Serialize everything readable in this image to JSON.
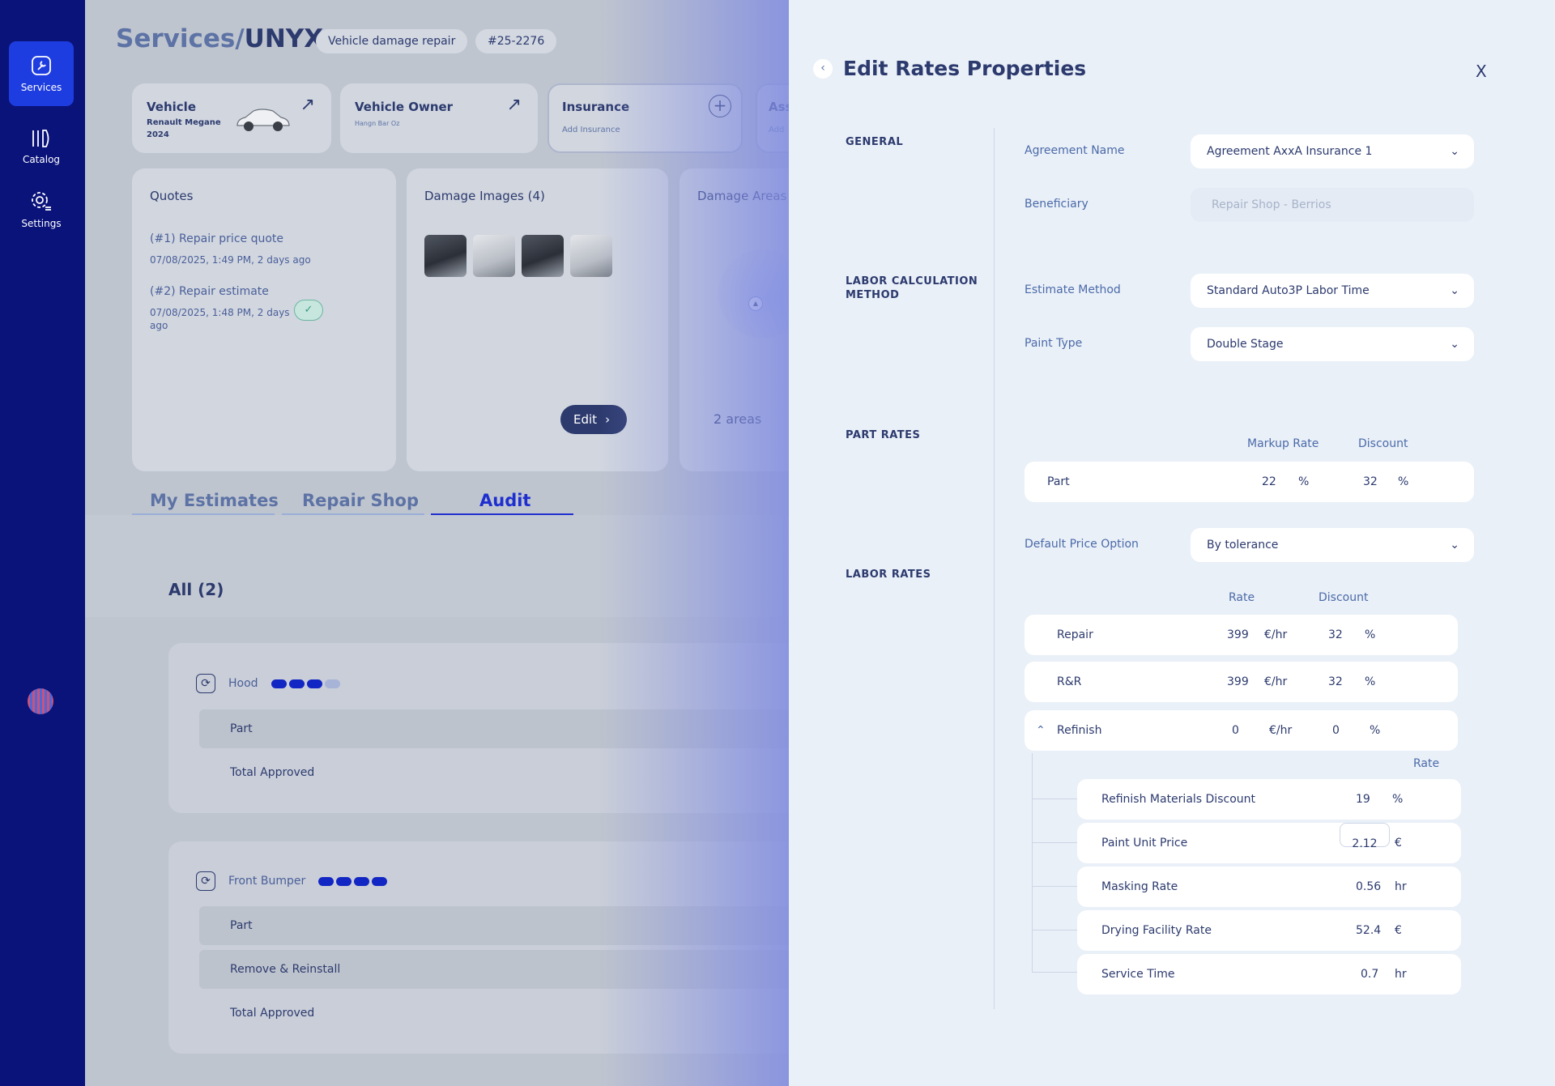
{
  "sidebar": {
    "items": [
      {
        "label": "Services",
        "icon": "wrench-icon",
        "active": true
      },
      {
        "label": "Catalog",
        "icon": "book-icon",
        "active": false
      },
      {
        "label": "Settings",
        "icon": "gear-icon",
        "active": false
      }
    ]
  },
  "header": {
    "breadcrumb_root": "Services/",
    "breadcrumb_current": "UNYX",
    "service_type": "Vehicle damage repair",
    "ticket_id": "#25-2276"
  },
  "cards": {
    "vehicle": {
      "title": "Vehicle",
      "line1": "Renault Megane",
      "line2": "2024"
    },
    "owner": {
      "title": "Vehicle Owner",
      "sub": "Hangn Bar Oz"
    },
    "insurance": {
      "title": "Insurance",
      "sub": "Add Insurance"
    },
    "assessor": {
      "title": "Ass",
      "sub": "Add"
    }
  },
  "quotes": {
    "title": "Quotes",
    "items": [
      {
        "label": "(#1) Repair price quote",
        "date": "07/08/2025, 1:49 PM, 2 days ago"
      },
      {
        "label": "(#2) Repair estimate",
        "date_line1": "07/08/2025, 1:48 PM, 2 days",
        "date_line2": "ago"
      }
    ]
  },
  "damage_images": {
    "title": "Damage Images (4)",
    "edit_label": "Edit"
  },
  "damage_areas": {
    "title": "Damage Areas",
    "count": "2 areas"
  },
  "tabs": [
    {
      "label": "My Estimates",
      "active": false
    },
    {
      "label": "Repair Shop",
      "active": false
    },
    {
      "label": "Audit",
      "active": true
    }
  ],
  "estimates": {
    "all_label": "All (2)",
    "groups": [
      {
        "name": "Hood",
        "progress_filled": 3,
        "progress_total": 4,
        "rows": [
          "Part",
          "Total Approved"
        ]
      },
      {
        "name": "Front Bumper",
        "progress_filled": 4,
        "progress_total": 4,
        "rows": [
          "Part",
          "Remove & Reinstall",
          "Total Approved"
        ]
      }
    ]
  },
  "drawer": {
    "title": "Edit Rates Properties",
    "close_label": "X",
    "sections": {
      "general": "GENERAL",
      "labor_calc_1": "LABOR CALCULATION",
      "labor_calc_2": "METHOD",
      "part_rates": "PART RATES",
      "labor_rates": "LABOR RATES"
    },
    "fields": {
      "agreement_name": {
        "label": "Agreement Name",
        "value": "Agreement AxxA Insurance 1"
      },
      "beneficiary": {
        "label": "Beneficiary",
        "placeholder": "Repair Shop - Berrios"
      },
      "estimate_method": {
        "label": "Estimate Method",
        "value": "Standard Auto3P Labor Time"
      },
      "paint_type": {
        "label": "Paint Type",
        "value": "Double Stage"
      },
      "default_price_option": {
        "label": "Default Price Option",
        "value": "By tolerance"
      }
    },
    "part_rates": {
      "col_markup": "Markup Rate",
      "col_discount": "Discount",
      "row": {
        "name": "Part",
        "markup": "22",
        "markup_unit": "%",
        "discount": "32",
        "discount_unit": "%"
      }
    },
    "labor_rates": {
      "col_rate": "Rate",
      "col_discount": "Discount",
      "rows": [
        {
          "name": "Repair",
          "rate": "399",
          "rate_unit": "€/hr",
          "discount": "32",
          "discount_unit": "%"
        },
        {
          "name": "R&R",
          "rate": "399",
          "rate_unit": "€/hr",
          "discount": "32",
          "discount_unit": "%"
        },
        {
          "name": "Refinish",
          "rate": "0",
          "rate_unit": "€/hr",
          "discount": "0",
          "discount_unit": "%"
        }
      ]
    },
    "refinish": {
      "col_rate": "Rate",
      "rows": [
        {
          "name": "Refinish Materials Discount",
          "value": "19",
          "unit": "%"
        },
        {
          "name": "Paint Unit Price",
          "value": "2.12",
          "unit": "€"
        },
        {
          "name": "Masking Rate",
          "value": "0.56",
          "unit": "hr"
        },
        {
          "name": "Drying Facility Rate",
          "value": "52.4",
          "unit": "€"
        },
        {
          "name": "Service Time",
          "value": "0.7",
          "unit": "hr"
        }
      ]
    }
  }
}
